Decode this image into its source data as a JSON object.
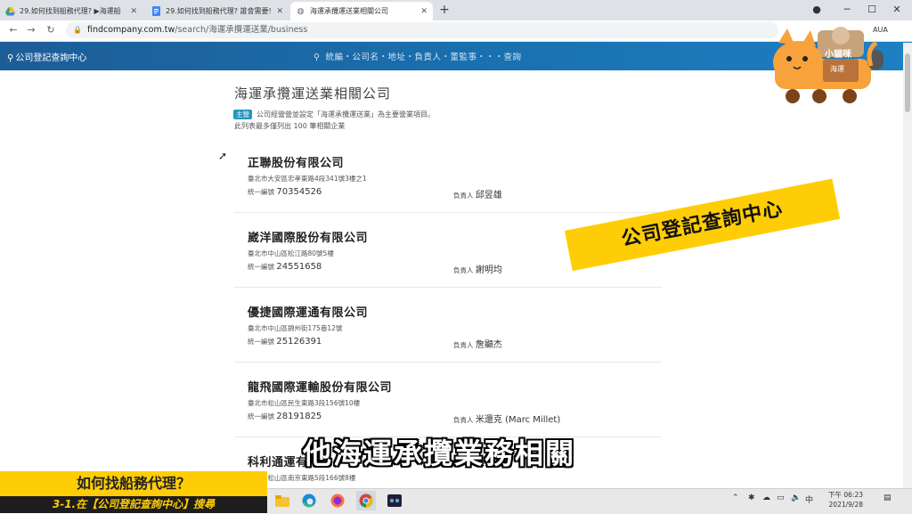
{
  "browser": {
    "tabs": [
      {
        "title": "29.如何找到船務代理? ▶海運船",
        "favicon": "drive-icon"
      },
      {
        "title": "29.如何找到船務代理? 誰會需要!",
        "favicon": "docs-icon"
      },
      {
        "title": "海運承攬運送業相關公司",
        "favicon": "globe-icon",
        "active": true
      }
    ],
    "new_tab": "+",
    "url_domain": "findcompany.com.tw",
    "url_path": "/search/海運承攬運送業/business",
    "profile_text": "AUA"
  },
  "site": {
    "brand": "公司登記查詢中心",
    "search_hint": "統編・公司名・地址・負責人・董監事・・・查詢"
  },
  "content": {
    "title": "海運承攬運送業相關公司",
    "badge": "主營",
    "notice_line1": "公司經營營並設定「海運承攬運送業」為主要營業項目。",
    "notice_line2": "此列表最多僅列出 100 筆相關企業",
    "id_label": "統一編號",
    "owner_label": "負責人",
    "companies": [
      {
        "name": "正聯股份有限公司",
        "address": "臺北市大安區忠孝東路4段341號3樓之1",
        "id": "70354526",
        "owner": "邱昱雄"
      },
      {
        "name": "崴洋國際股份有限公司",
        "address": "臺北市中山區松江路80號5樓",
        "id": "24551658",
        "owner": "謝明均"
      },
      {
        "name": "優捷國際運通有限公司",
        "address": "臺北市中山區錦州街175巷12號",
        "id": "25126391",
        "owner": "詹顯杰"
      },
      {
        "name": "龍飛國際運輸股份有限公司",
        "address": "臺北市松山區民生東路3段156號10樓",
        "id": "28191825",
        "owner": "米還克 (Marc Millet)"
      },
      {
        "name": "科利通運有",
        "address": "臺北市松山區南京東路5段166號8樓",
        "id": "",
        "owner": ""
      }
    ]
  },
  "overlay": {
    "banner": "公司登記查詢中心",
    "subtitle": "他海運承攬業務相關",
    "caption_title": "如何找船務代理？",
    "caption_sub": "3-1.在【公司登記查詢中心】搜尋",
    "mascot_name": "小貓咪",
    "mascot_sub": "海運"
  },
  "taskbar": {
    "ime": "中",
    "clock_label": "下午 06:23",
    "date": "2021/9/28"
  },
  "colors": {
    "header": "#1a6fae",
    "accent_yellow": "#ffcd05",
    "badge": "#2596be"
  }
}
